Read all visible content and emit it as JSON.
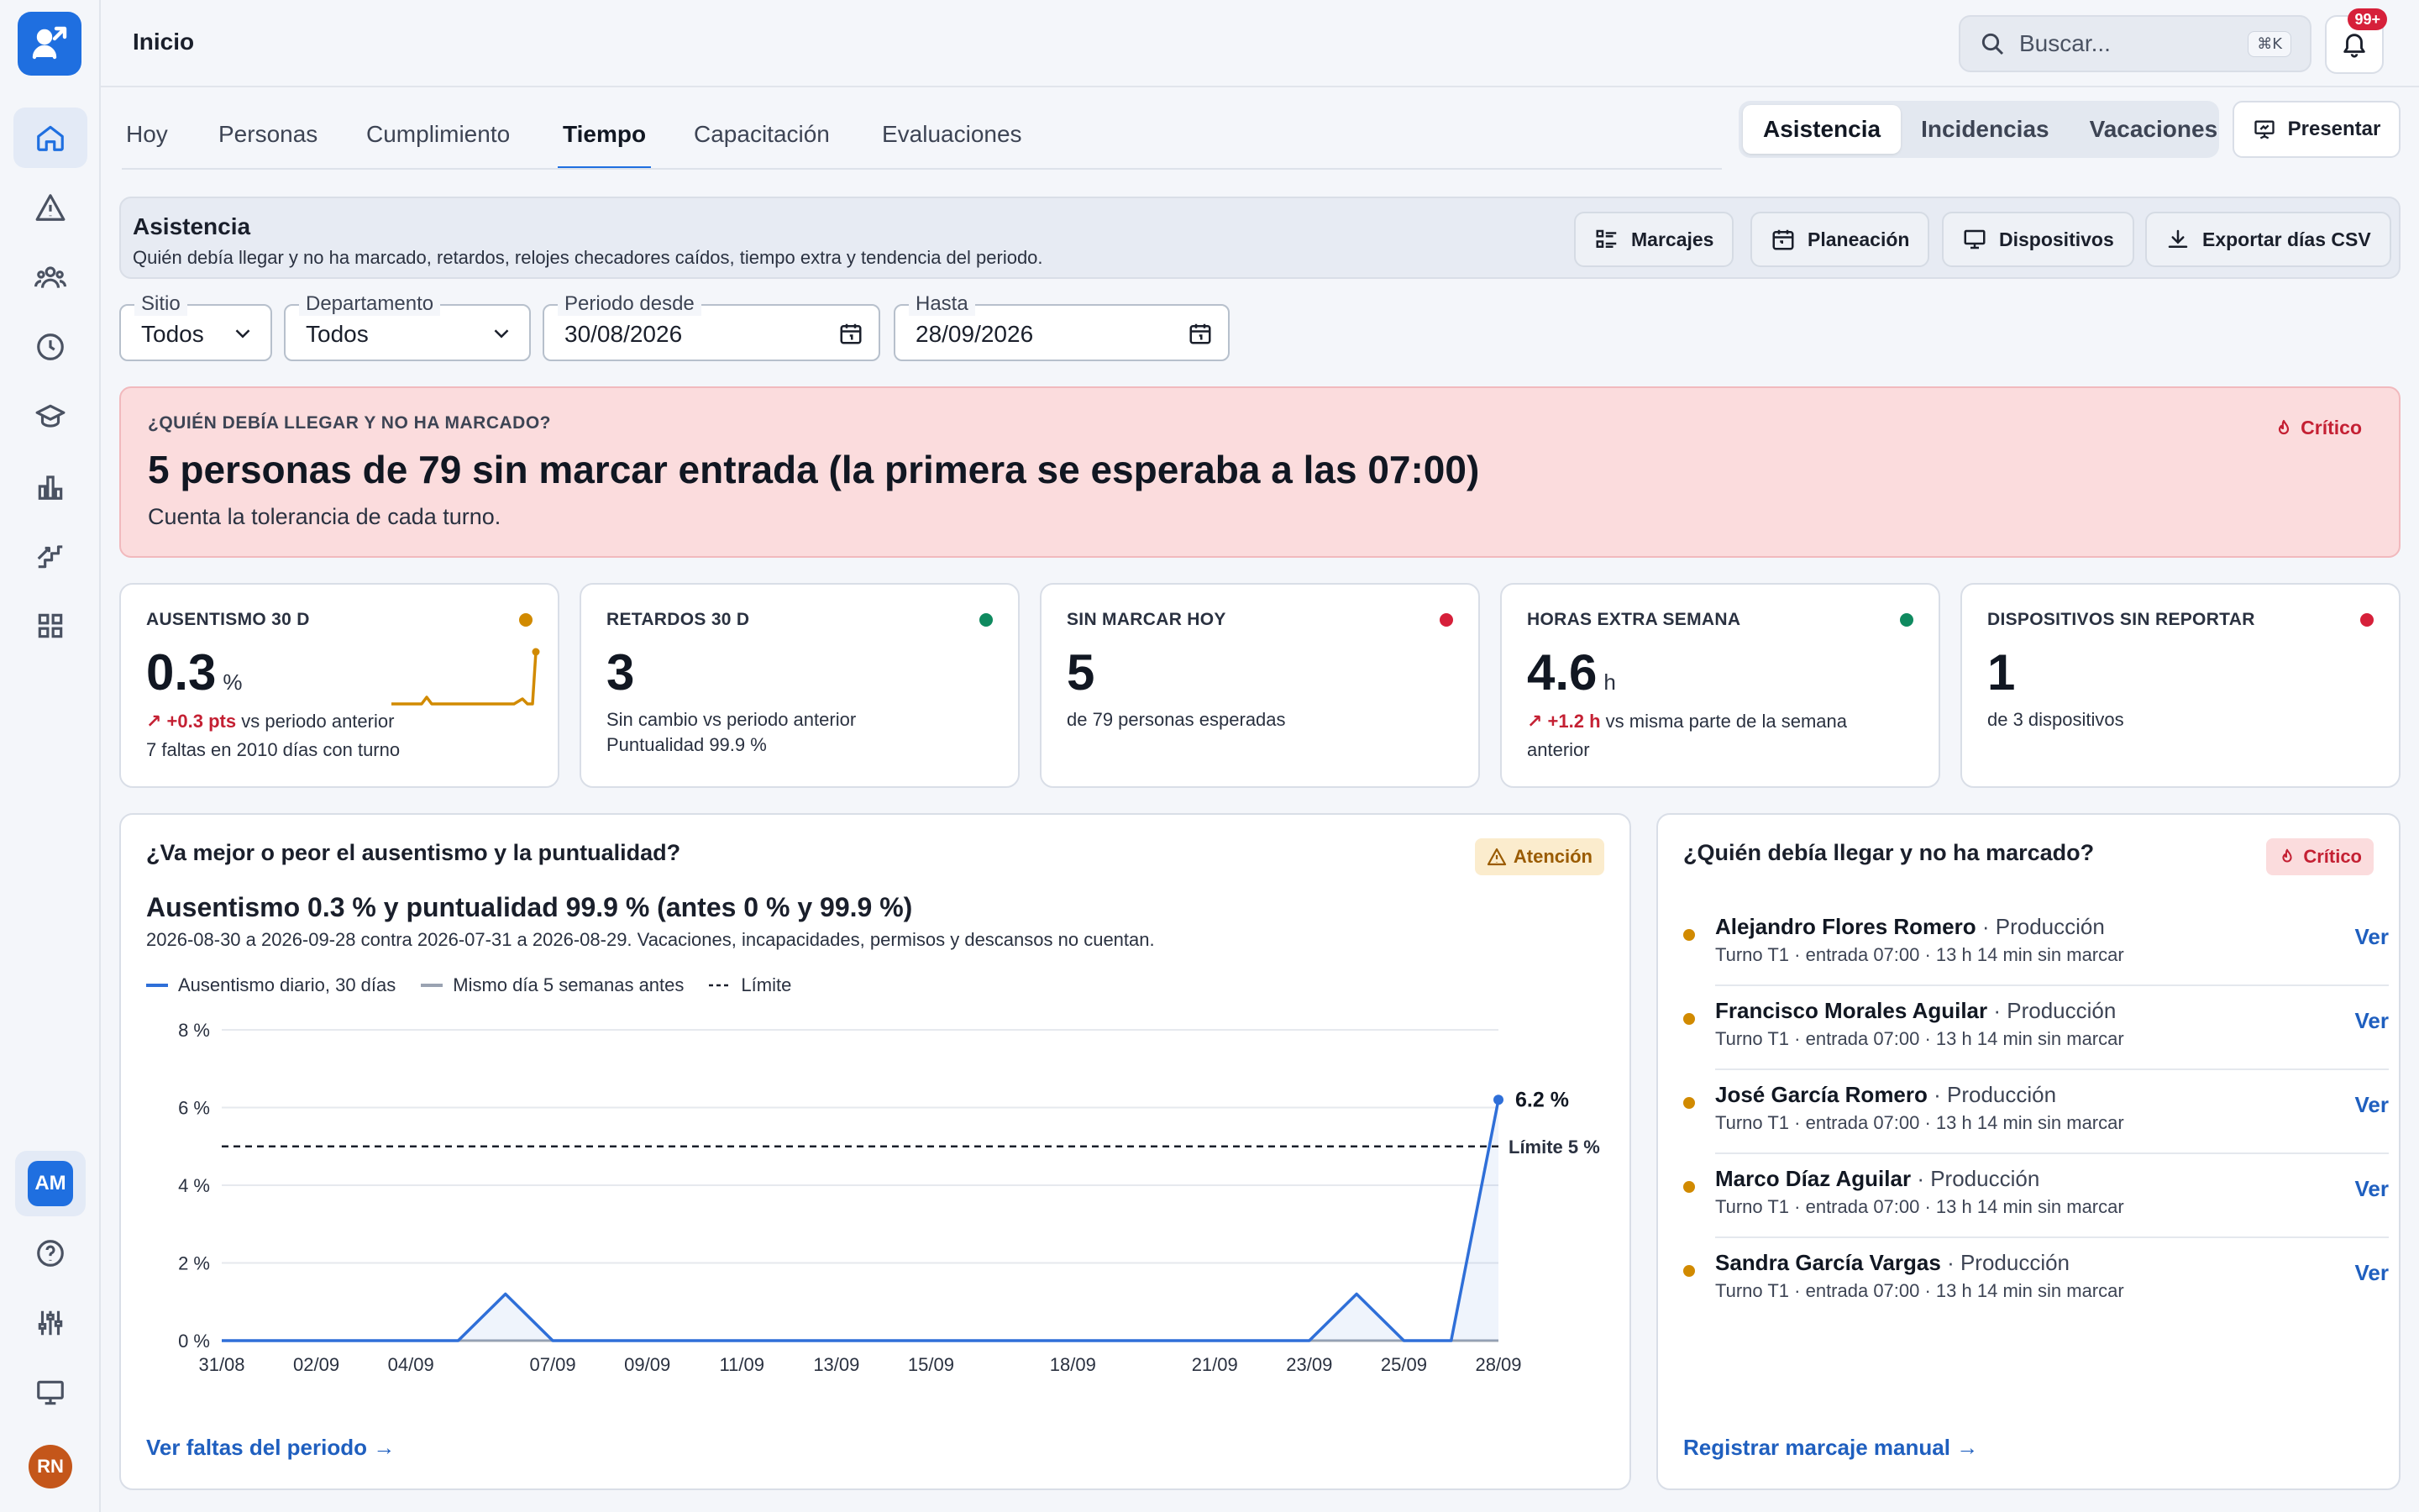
{
  "header": {
    "breadcrumb": "Inicio",
    "search_placeholder": "Buscar...",
    "search_shortcut": "⌘K",
    "notifications_badge": "99+"
  },
  "tabs": [
    "Hoy",
    "Personas",
    "Cumplimiento",
    "Tiempo",
    "Capacitación",
    "Evaluaciones"
  ],
  "active_tab": "Tiempo",
  "segment": {
    "items": [
      "Asistencia",
      "Incidencias",
      "Vacaciones"
    ],
    "active": "Asistencia"
  },
  "present_label": "Presentar",
  "section": {
    "title": "Asistencia",
    "subtitle": "Quién debía llegar y no ha marcado, retardos, relojes checadores caídos, tiempo extra y tendencia del periodo.",
    "buttons": [
      "Marcajes",
      "Planeación",
      "Dispositivos",
      "Exportar días CSV"
    ]
  },
  "filters": {
    "site": {
      "label": "Sitio",
      "value": "Todos"
    },
    "department": {
      "label": "Departamento",
      "value": "Todos"
    },
    "from": {
      "label": "Periodo desde",
      "value": "30/08/2026"
    },
    "to": {
      "label": "Hasta",
      "value": "28/09/2026"
    }
  },
  "alert": {
    "kicker": "¿QUIÉN DEBÍA LLEGAR Y NO HA MARCADO?",
    "headline": "5 personas de 79 sin marcar entrada (la primera se esperaba a las 07:00)",
    "note": "Cuenta la tolerancia de cada turno.",
    "severity": "Crítico"
  },
  "kpis": [
    {
      "key": "AUSENTISMO 30 D",
      "value": "0.3",
      "unit": "%",
      "delta": "+0.3 pts",
      "delta_text": "vs periodo anterior",
      "line2": "7 faltas en 2010 días con turno",
      "status_color": "#d18a00"
    },
    {
      "key": "RETARDOS 30 D",
      "value": "3",
      "unit": "",
      "line1": "Sin cambio vs periodo anterior",
      "line2": "Puntualidad 99.9 %",
      "status_color": "#0f8a5f"
    },
    {
      "key": "SIN MARCAR HOY",
      "value": "5",
      "unit": "",
      "line1": "de 79 personas esperadas",
      "status_color": "#d6203a"
    },
    {
      "key": "HORAS EXTRA SEMANA",
      "value": "4.6",
      "unit": "h",
      "delta": "+1.2 h",
      "delta_text": "vs misma parte de la semana",
      "line2": "anterior",
      "status_color": "#0f8a5f"
    },
    {
      "key": "DISPOSITIVOS SIN REPORTAR",
      "value": "1",
      "unit": "",
      "line1": "de 3 dispositivos",
      "status_color": "#d6203a"
    }
  ],
  "trend_panel": {
    "title": "¿Va mejor o peor el ausentismo y la puntualidad?",
    "tag": "Atención",
    "headline": "Ausentismo 0.3 % y puntualidad 99.9 % (antes 0 % y 99.9 %)",
    "subtitle": "2026-08-30 a 2026-09-28 contra 2026-07-31 a 2026-08-29. Vacaciones, incapacidades, permisos y descansos no cuentan.",
    "legend": [
      "Ausentismo diario, 30 días",
      "Mismo día 5 semanas antes",
      "Límite"
    ],
    "link": "Ver faltas del periodo →"
  },
  "chart_data": {
    "type": "line",
    "x": [
      "31/08",
      "01/09",
      "02/09",
      "03/09",
      "04/09",
      "05/09",
      "06/09",
      "07/09",
      "08/09",
      "09/09",
      "10/09",
      "11/09",
      "12/09",
      "13/09",
      "14/09",
      "15/09",
      "16/09",
      "17/09",
      "18/09",
      "19/09",
      "20/09",
      "21/09",
      "22/09",
      "23/09",
      "24/09",
      "25/09",
      "26/09",
      "27/09",
      "28/09"
    ],
    "x_tick_labels": [
      "31/08",
      "02/09",
      "04/09",
      "07/09",
      "09/09",
      "11/09",
      "13/09",
      "15/09",
      "18/09",
      "21/09",
      "23/09",
      "25/09",
      "28/09"
    ],
    "series": [
      {
        "name": "Ausentismo diario, 30 días",
        "color": "#2f6fd8",
        "values": [
          0,
          0,
          0,
          0,
          0,
          0,
          1.2,
          0,
          0,
          0,
          0,
          0,
          0,
          0,
          0,
          0,
          0,
          0,
          0,
          0,
          0,
          0,
          0,
          0,
          1.2,
          0,
          0,
          6.2
        ]
      },
      {
        "name": "Mismo día 5 semanas antes",
        "color": "#9aa3b2",
        "values": [
          0,
          0,
          0,
          0,
          0,
          0,
          0,
          0,
          0,
          0,
          0,
          0,
          0,
          0,
          0,
          0,
          0,
          0,
          0,
          0,
          0,
          0,
          0,
          0,
          0,
          0,
          0,
          0
        ]
      }
    ],
    "threshold": {
      "name": "Límite",
      "value": 5,
      "label": "Límite 5 %"
    },
    "last_value_label": "6.2 %",
    "y_ticks": [
      "0 %",
      "2 %",
      "4 %",
      "6 %",
      "8 %"
    ],
    "ylim": [
      0,
      8
    ]
  },
  "missing_panel": {
    "title": "¿Quién debía llegar y no ha marcado?",
    "tag": "Crítico",
    "rows": [
      {
        "name": "Alejandro Flores Romero",
        "dept": "· Producción",
        "detail": "Turno T1 · entrada 07:00 · 13 h 14 min sin marcar",
        "action": "Ver"
      },
      {
        "name": "Francisco Morales Aguilar",
        "dept": "· Producción",
        "detail": "Turno T1 · entrada 07:00 · 13 h 14 min sin marcar",
        "action": "Ver"
      },
      {
        "name": "José García Romero",
        "dept": "· Producción",
        "detail": "Turno T1 · entrada 07:00 · 13 h 14 min sin marcar",
        "action": "Ver"
      },
      {
        "name": "Marco Díaz Aguilar",
        "dept": "· Producción",
        "detail": "Turno T1 · entrada 07:00 · 13 h 14 min sin marcar",
        "action": "Ver"
      },
      {
        "name": "Sandra García Vargas",
        "dept": "· Producción",
        "detail": "Turno T1 · entrada 07:00 · 13 h 14 min sin marcar",
        "action": "Ver"
      }
    ],
    "link": "Registrar marcaje manual →"
  },
  "user": {
    "workspace_initials": "AM",
    "user_initials": "RN"
  }
}
